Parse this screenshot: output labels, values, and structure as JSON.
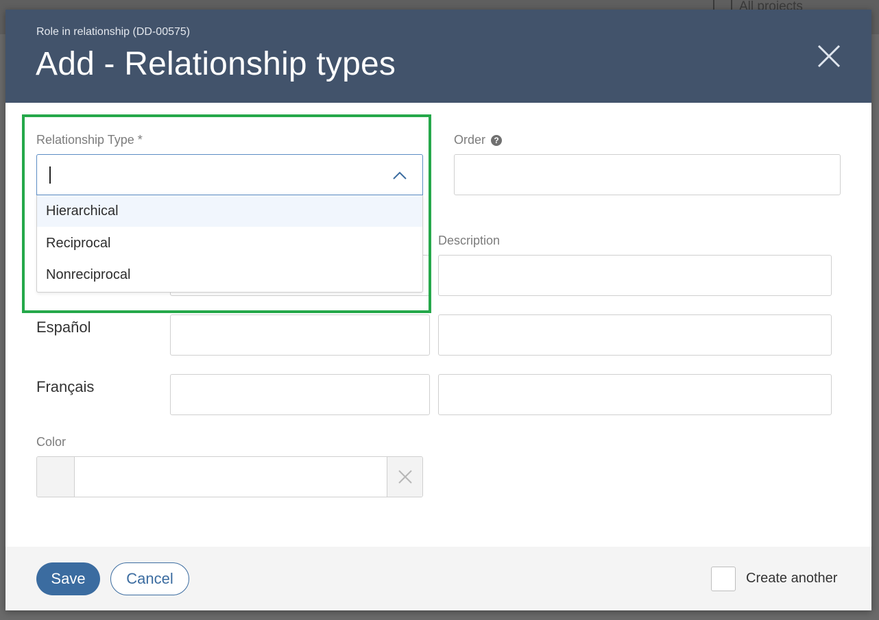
{
  "background": {
    "top_link": "All projects"
  },
  "modal": {
    "subtitle": "Role in relationship (DD-00575)",
    "title": "Add - Relationship types",
    "close_icon": "close-icon"
  },
  "form": {
    "relationship_type": {
      "label": "Relationship Type *",
      "value": "",
      "options": [
        "Hierarchical",
        "Reciprocal",
        "Nonreciprocal"
      ],
      "highlighted_option": "Hierarchical"
    },
    "order": {
      "label": "Order",
      "help_icon": "question-circle-icon",
      "value": ""
    },
    "description_label": "Description",
    "languages": [
      {
        "label": "Español",
        "name": "",
        "description": ""
      },
      {
        "label": "Français",
        "name": "",
        "description": ""
      }
    ],
    "color": {
      "label": "Color",
      "value": "",
      "clear_icon": "close-icon"
    }
  },
  "footer": {
    "save_label": "Save",
    "cancel_label": "Cancel",
    "create_another_label": "Create another",
    "create_another_checked": false
  },
  "colors": {
    "header_bg": "#42536b",
    "accent": "#3b6ca0",
    "highlight": "#25a84a"
  }
}
